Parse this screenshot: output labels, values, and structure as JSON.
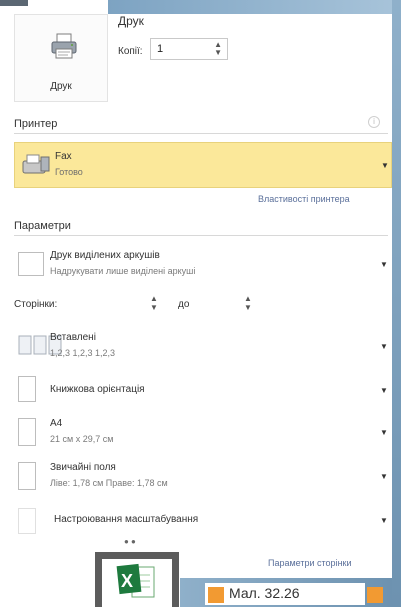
{
  "print": {
    "button_label": "Друк",
    "title": "Друк",
    "copies_label": "Копії:",
    "copies_value": "1"
  },
  "printer": {
    "section_title": "Принтер",
    "name": "Fax",
    "status": "Готово",
    "properties_link": "Властивості принтера"
  },
  "settings": {
    "section_title": "Параметри",
    "print_what": {
      "main": "Друк виділених аркушів",
      "sub": "Надрукувати лише виділені аркуші"
    },
    "pages": {
      "label": "Сторінки:",
      "to_label": "до"
    },
    "collation": {
      "main": "Вставлені",
      "sub": "1,2,3    1,2,3    1,2,3"
    },
    "orientation": {
      "main": "Книжкова орієнтація"
    },
    "paper": {
      "main": "A4",
      "sub": "21 см x 29,7 см"
    },
    "margins": {
      "main": "Звичайні поля",
      "sub": "Ліве: 1,78 см    Праве: 1,78 см"
    },
    "scaling": {
      "main": "Настроювання масштабування"
    },
    "page_setup_link": "Параметри сторінки"
  },
  "caption": {
    "text": "Мал. 32.26"
  },
  "colors": {
    "printer_highlight": "#fbe89a",
    "caption_accent": "#f29a32",
    "excel_green": "#1e7a3e"
  }
}
